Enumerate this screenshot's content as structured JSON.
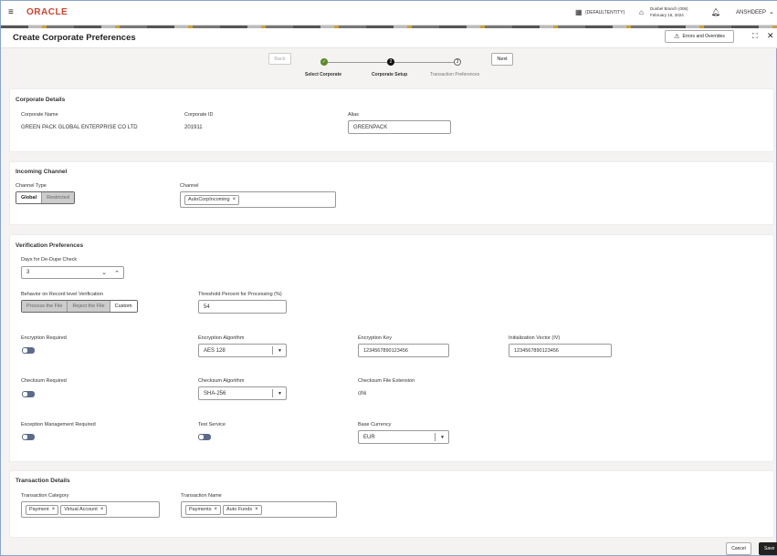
{
  "header": {
    "logo": "ORACLE",
    "entity": "(DEFAULTENTITY)",
    "branch": "Dunbel Branch (006)",
    "date": "February 15, 2024",
    "user": "ANSHDEEP"
  },
  "page": {
    "title": "Create Corporate Preferences",
    "errors_button": "Errors and Overrides"
  },
  "stepper": {
    "back": "Back",
    "next": "Next",
    "steps": [
      {
        "label": "Select Corporate",
        "num": "✓"
      },
      {
        "label": "Corporate Setup",
        "num": "2"
      },
      {
        "label": "Transaction Preferences",
        "num": "3"
      }
    ]
  },
  "corporate_details": {
    "title": "Corporate Details",
    "name_label": "Corporate Name",
    "name": "GREEN PACK GLOBAL ENTERPRISE CO LTD",
    "id_label": "Corporate ID",
    "id": "201911",
    "alias_label": "Alias",
    "alias": "GREENPACK"
  },
  "incoming_channel": {
    "title": "Incoming Channel",
    "type_label": "Channel Type",
    "types": [
      "Global",
      "Restricted"
    ],
    "channel_label": "Channel",
    "channels": [
      "AutoCorpIncoming"
    ]
  },
  "verification": {
    "title": "Verification Preferences",
    "dedupe_label": "Days for De-Dupe Check",
    "dedupe": "3",
    "behavior_label": "Behavior on Record level Verification",
    "behaviors": [
      "Process the File",
      "Reject the File",
      "Custom"
    ],
    "threshold_label": "Threshold Percent for Processing (%)",
    "threshold": "54",
    "enc_req_label": "Encryption Required",
    "enc_algo_label": "Encryption Algorithm",
    "enc_algo": "AES 128",
    "enc_key_label": "Encryption Key",
    "enc_key": "1234567890123456",
    "iv_label": "Initialization Vector (IV)",
    "iv": "1234567890123456",
    "chk_req_label": "Checksum Required",
    "chk_algo_label": "Checksum Algorithm",
    "chk_algo": "SHA-256",
    "chk_ext_label": "Checksum File Extension",
    "chk_ext": "chk",
    "exc_label": "Exception Management Required",
    "test_label": "Test Service",
    "currency_label": "Base Currency",
    "currency": "EUR"
  },
  "transaction": {
    "title": "Transaction Details",
    "category_label": "Transaction Category",
    "categories": [
      "Payment",
      "Virtual Account"
    ],
    "name_label": "Transaction Name",
    "names": [
      "Payments",
      "Auto Funds"
    ]
  },
  "footer": {
    "cancel": "Cancel",
    "save": "Save"
  }
}
